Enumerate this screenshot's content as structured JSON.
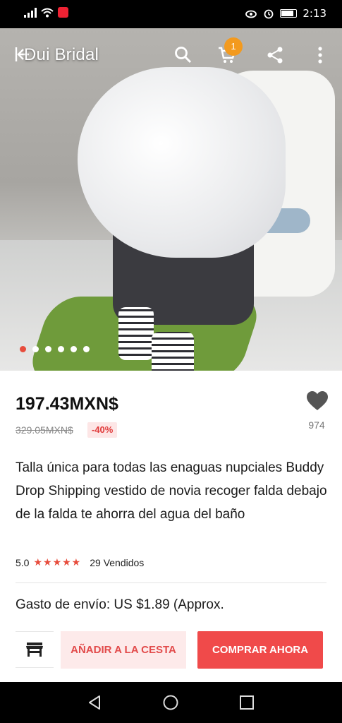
{
  "status_bar": {
    "time": "2:13"
  },
  "header": {
    "store_name": "Dui Bridal",
    "cart_count": "1"
  },
  "gallery": {
    "dot_count": 6,
    "active_index": 0
  },
  "product": {
    "price": "197.43MXN$",
    "original_price": "329.05MXN$",
    "discount": "-40%",
    "wish_count": "974",
    "title": "Talla única para todas las enaguas nupciales Buddy Drop Shipping vestido de novia recoger falda debajo de la falda te ahorra del agua del baño",
    "rating": "5.0",
    "stars": "★★★★★",
    "sold": "29 Vendidos",
    "shipping": "Gasto de envío: US $1.89 (Approx."
  },
  "actions": {
    "add_to_cart": "AÑADIR A LA CESTA",
    "buy_now": "COMPRAR AHORA"
  },
  "colors": {
    "accent": "#f04a4a",
    "badge": "#f39a1e"
  }
}
